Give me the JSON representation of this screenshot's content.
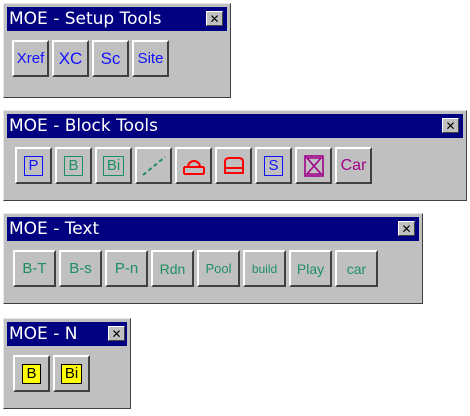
{
  "toolbars": [
    {
      "title": "MOE - Setup Tools",
      "close_icon": "close-icon",
      "buttons": [
        {
          "label": "Xref",
          "color": "#1010ff"
        },
        {
          "label": "XC",
          "color": "#1010ff"
        },
        {
          "label": "Sc",
          "color": "#1010ff"
        },
        {
          "label": "Site",
          "color": "#1010ff"
        }
      ]
    },
    {
      "title": "MOE - Block Tools",
      "close_icon": "close-icon",
      "buttons": [
        {
          "label": "P",
          "color": "#1010ff",
          "icon": "boxed-letter"
        },
        {
          "label": "B",
          "color": "#1e8f63",
          "icon": "boxed-letter"
        },
        {
          "label": "Bi",
          "color": "#1e8f63",
          "icon": "boxed-letter"
        },
        {
          "label": "",
          "icon": "dashed-line-icon",
          "color": "#1e8f63"
        },
        {
          "label": "",
          "icon": "chair-icon",
          "color": "#ff0000"
        },
        {
          "label": "",
          "icon": "seat-icon",
          "color": "#ff0000"
        },
        {
          "label": "S",
          "color": "#1010ff",
          "icon": "boxed-letter"
        },
        {
          "label": "",
          "icon": "hourglass-icon",
          "color": "#a0008a"
        },
        {
          "label": "Car",
          "color": "#a0008a"
        }
      ]
    },
    {
      "title": "MOE - Text",
      "close_icon": "close-icon",
      "buttons": [
        {
          "label": "B-T",
          "color": "#1e8f63"
        },
        {
          "label": "B-s",
          "color": "#1e8f63"
        },
        {
          "label": "P-n",
          "color": "#1e8f63"
        },
        {
          "label": "Rdn",
          "color": "#1e8f63"
        },
        {
          "label": "Pool",
          "color": "#1e8f63"
        },
        {
          "label": "build",
          "color": "#1e8f63"
        },
        {
          "label": "Play",
          "color": "#1e8f63"
        },
        {
          "label": "car",
          "color": "#1e8f63"
        }
      ]
    },
    {
      "title": "MOE - N",
      "close_icon": "close-icon",
      "buttons": [
        {
          "label": "B",
          "color": "#000000",
          "icon": "yellow-boxed-letter"
        },
        {
          "label": "Bi",
          "color": "#000000",
          "icon": "yellow-boxed-letter"
        }
      ]
    }
  ]
}
